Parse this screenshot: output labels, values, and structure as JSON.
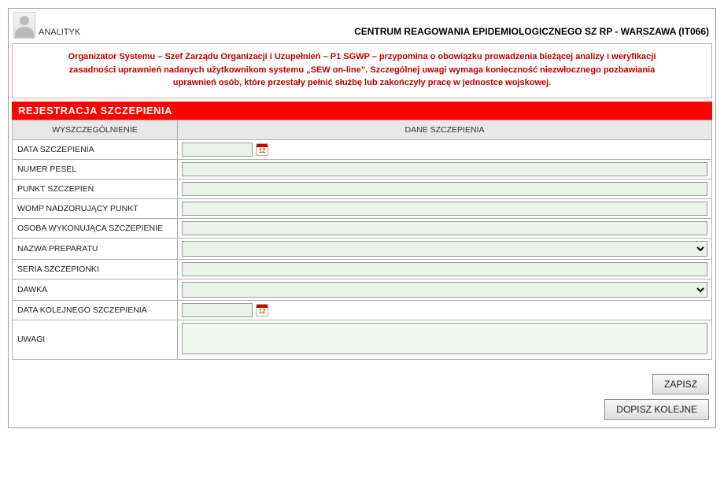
{
  "header": {
    "role": "ANALITYK",
    "org_title": "CENTRUM REAGOWANIA EPIDEMIOLOGICZNEGO SZ RP - WARSZAWA (IT066)"
  },
  "notice": {
    "line1": "Organizator Systemu – Szef Zarządu Organizacji i Uzupełnień – P1 SGWP – przypomina o obowiązku prowadzenia bieżącej analizy i weryfikacji",
    "line2": "zasadności uprawnień nadanych użytkownikom systemu „SEW on-line”. Szczególnej uwagi wymaga konieczność niezwłocznego pozbawiania",
    "line3": "uprawnień osób, które przestały pełnić służbę lub zakończyły pracę w jednostce wojskowej."
  },
  "section_title": "REJESTRACJA SZCZEPIENIA",
  "columns": {
    "label": "WYSZCZEGÓLNIENIE",
    "field": "DANE SZCZEPIENIA"
  },
  "rows": {
    "data_szczepienia": "DATA SZCZEPIENIA",
    "numer_pesel": "NUMER PESEL",
    "punkt_szczepien": "PUNKT SZCZEPIEŃ",
    "womp": "WOMP NADZORUJĄCY PUNKT",
    "osoba": "OSOBA WYKONUJĄCA SZCZEPIENIE",
    "preparat": "NAZWA PREPARATU",
    "seria": "SERIA SZCZEPIONKI",
    "dawka": "DAWKA",
    "data_kolejnego": "DATA KOLEJNEGO SZCZEPIENIA",
    "uwagi": "UWAGI"
  },
  "values": {
    "data_szczepienia": "",
    "numer_pesel": "",
    "punkt_szczepien": "",
    "womp": "",
    "osoba": "",
    "preparat": "",
    "seria": "",
    "dawka": "",
    "data_kolejnego": "",
    "uwagi": ""
  },
  "buttons": {
    "save": "ZAPISZ",
    "add_next": "DOPISZ KOLEJNE"
  }
}
